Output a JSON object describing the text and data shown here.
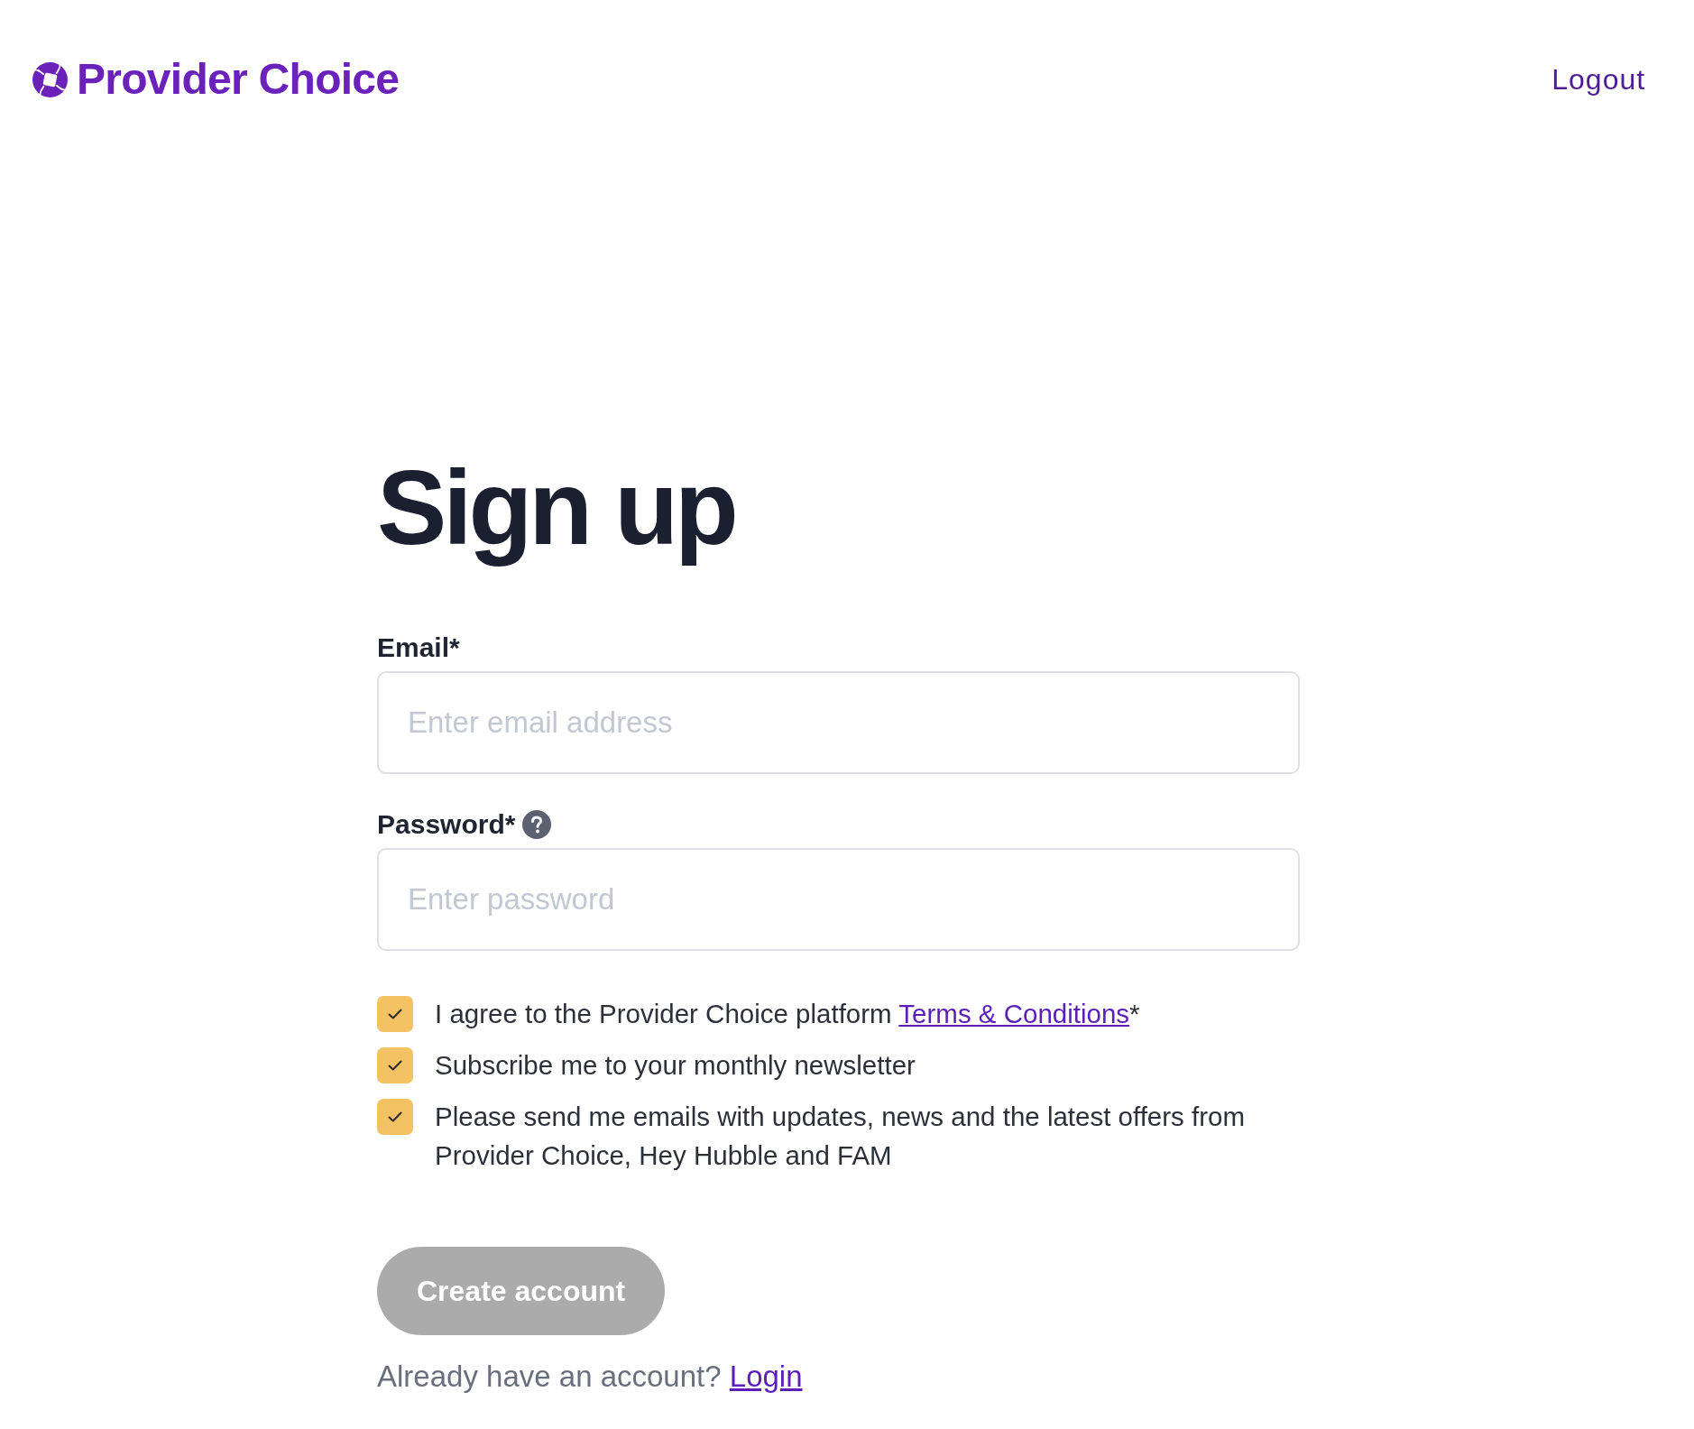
{
  "header": {
    "brand": "Provider Choice",
    "logout": "Logout"
  },
  "title": "Sign up",
  "fields": [
    {
      "label": "Email*",
      "placeholder": "Enter email address",
      "help": false
    },
    {
      "label": "Password*",
      "placeholder": "Enter password",
      "help": true
    }
  ],
  "consents": [
    {
      "text": "I agree to the Provider Choice platform",
      "link": "Terms & Conditions",
      "suffix": "*",
      "checked": true
    },
    {
      "text": "Subscribe me to your monthly newsletter",
      "checked": true
    },
    {
      "text": "Please send me emails with updates, news and the latest offers from Provider Choice, Hey Hubble and FAM",
      "checked": true
    }
  ],
  "submit": {
    "label": "Create account",
    "disabled": true
  },
  "login_prompt": {
    "text": "Already have an account?",
    "link": "Login"
  }
}
